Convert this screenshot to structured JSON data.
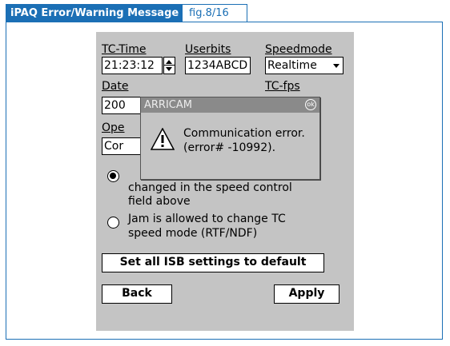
{
  "header": {
    "title": "iPAQ Error/Warning Message",
    "figure": "fig.8/16"
  },
  "form": {
    "tc_time_label": "TC-Time",
    "userbits_label": "Userbits",
    "speedmode_label": "Speedmode",
    "tc_time_value": "21:23:12",
    "userbits_value": "1234ABCD",
    "speedmode_value": "Realtime",
    "date_label": "Date",
    "date_value": "200",
    "tc_fps_label": "TC-fps",
    "ope_label": "Ope",
    "ope_value": "Cor",
    "radio1_line1": "changed in the speed control",
    "radio1_line2": "field above",
    "radio2_line1": "Jam is allowed to change TC",
    "radio2_line2": "speed mode (RTF/NDF)",
    "reset_button": "Set all ISB settings to default",
    "back_button": "Back",
    "apply_button": "Apply"
  },
  "dialog": {
    "title": "ARRICAM",
    "ok": "ok",
    "message_line1": "Communication error.",
    "message_line2": "(error# -10992)."
  }
}
